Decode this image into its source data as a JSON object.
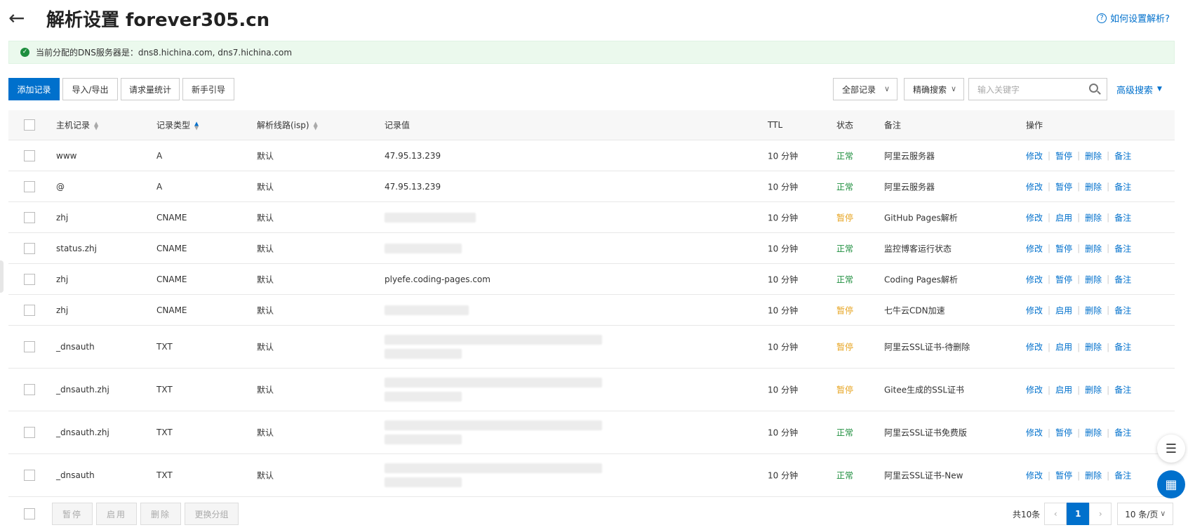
{
  "header": {
    "title": "解析设置 forever305.cn",
    "help": "如何设置解析?",
    "back_icon": "arrow-left-icon"
  },
  "alert": {
    "text": "当前分配的DNS服务器是：dns8.hichina.com, dns7.hichina.com"
  },
  "toolbar": {
    "add": "添加记录",
    "import_export": "导入/导出",
    "stats": "请求量统计",
    "guide": "新手引导",
    "filter": "全部记录",
    "mode": "精确搜索",
    "search_placeholder": "输入关键字",
    "advanced": "高级搜索"
  },
  "columns": {
    "host": "主机记录",
    "type": "记录类型",
    "line": "解析线路(isp)",
    "value": "记录值",
    "ttl": "TTL",
    "status": "状态",
    "remark": "备注",
    "action": "操作"
  },
  "rows": [
    {
      "host": "www",
      "type": "A",
      "line": "默认",
      "value": "47.95.13.239",
      "blur": 0,
      "ttl": "10 分钟",
      "status": "正常",
      "st": "ok",
      "remark": "阿里云服务器",
      "toggle": "暂停"
    },
    {
      "host": "@",
      "type": "A",
      "line": "默认",
      "value": "47.95.13.239",
      "blur": 0,
      "ttl": "10 分钟",
      "status": "正常",
      "st": "ok",
      "remark": "阿里云服务器",
      "toggle": "暂停"
    },
    {
      "host": "zhj",
      "type": "CNAME",
      "line": "默认",
      "value": "",
      "blur": 1,
      "ttl": "10 分钟",
      "status": "暂停",
      "st": "pause",
      "remark": "GitHub Pages解析",
      "toggle": "启用"
    },
    {
      "host": "status.zhj",
      "type": "CNAME",
      "line": "默认",
      "value": "",
      "blur": 1,
      "ttl": "10 分钟",
      "status": "正常",
      "st": "ok",
      "remark": "监控博客运行状态",
      "toggle": "暂停"
    },
    {
      "host": "zhj",
      "type": "CNAME",
      "line": "默认",
      "value": "plyefe.coding-pages.com",
      "blur": 0,
      "ttl": "10 分钟",
      "status": "正常",
      "st": "ok",
      "remark": "Coding Pages解析",
      "toggle": "暂停"
    },
    {
      "host": "zhj",
      "type": "CNAME",
      "line": "默认",
      "value": "",
      "blur": 1,
      "ttl": "10 分钟",
      "status": "暂停",
      "st": "pause",
      "remark": "七牛云CDN加速",
      "toggle": "启用"
    },
    {
      "host": "_dnsauth",
      "type": "TXT",
      "line": "默认",
      "value": "",
      "blur": 2,
      "ttl": "10 分钟",
      "status": "暂停",
      "st": "pause",
      "remark": "阿里云SSL证书-待删除",
      "toggle": "启用"
    },
    {
      "host": "_dnsauth.zhj",
      "type": "TXT",
      "line": "默认",
      "value": "",
      "blur": 2,
      "ttl": "10 分钟",
      "status": "暂停",
      "st": "pause",
      "remark": "Gitee生成的SSL证书",
      "toggle": "启用"
    },
    {
      "host": "_dnsauth.zhj",
      "type": "TXT",
      "line": "默认",
      "value": "",
      "blur": 2,
      "ttl": "10 分钟",
      "status": "正常",
      "st": "ok",
      "remark": "阿里云SSL证书免费版",
      "toggle": "暂停"
    },
    {
      "host": "_dnsauth",
      "type": "TXT",
      "line": "默认",
      "value": "",
      "blur": 2,
      "ttl": "10 分钟",
      "status": "正常",
      "st": "ok",
      "remark": "阿里云SSL证书-New",
      "toggle": "暂停"
    }
  ],
  "ops": {
    "edit": "修改",
    "delete": "删除",
    "note": "备注"
  },
  "footer": {
    "pause": "暂停",
    "enable": "启用",
    "delete": "删除",
    "group": "更换分组",
    "total": "共10条",
    "page": "1",
    "per_page": "10 条/页"
  },
  "colors": {
    "primary": "#0070cc",
    "ok": "#1e8e3e",
    "pause": "#e7a523"
  }
}
